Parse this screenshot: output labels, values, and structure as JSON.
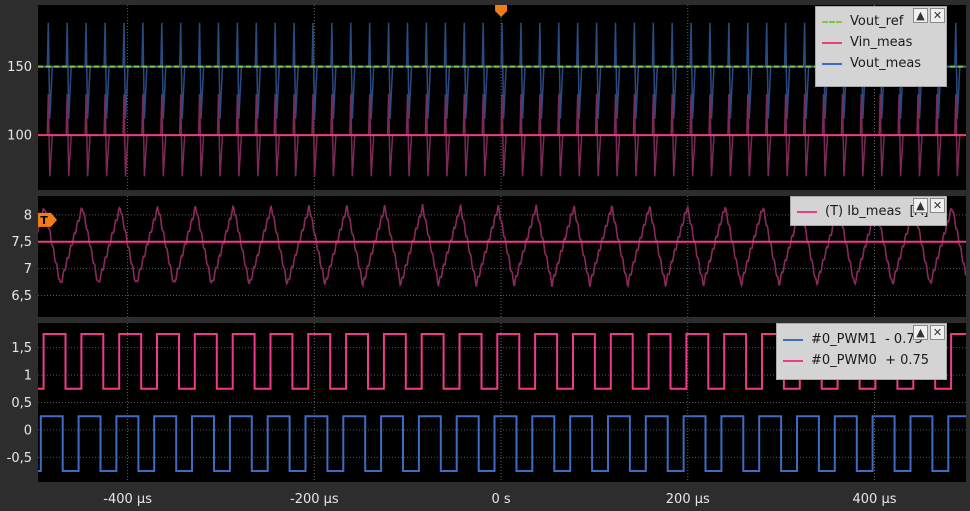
{
  "chart_data": [
    {
      "type": "line",
      "panel": "top",
      "yticks": [
        100,
        150
      ],
      "ylim": [
        60,
        195
      ],
      "x_ticks": [
        -400,
        -200,
        0,
        200,
        400
      ],
      "x_tick_labels": [
        "-400 µs",
        "-200 µs",
        "0 s",
        "200 µs",
        "400 µs"
      ],
      "xlim": [
        -496,
        498
      ],
      "grid": true,
      "legend_position": "top-right",
      "series": [
        {
          "name": "Vout_ref",
          "color": "#7ec843",
          "style": "dashed",
          "value": 150
        },
        {
          "name": "Vin_meas",
          "color": "#ee3b86",
          "value": 100,
          "spike_range": [
            70,
            130
          ]
        },
        {
          "name": "Vout_meas",
          "color": "#3d6cc2",
          "value": 150,
          "spike_range": [
            112,
            182
          ]
        }
      ]
    },
    {
      "type": "line",
      "panel": "middle",
      "yticks": [
        6.5,
        7,
        7.5,
        8
      ],
      "ytick_labels": [
        "6,5",
        "7",
        "7,5",
        "8"
      ],
      "ylim": [
        6.1,
        8.35
      ],
      "grid": true,
      "trigger_marker": "T",
      "trigger_level": 8,
      "legend_position": "top-right",
      "series": [
        {
          "name": "(T) Ib_meas  [A]",
          "color": "#ee3b86",
          "mean": 7.5,
          "ripple_min": 6.7,
          "ripple_max": 8.15
        }
      ]
    },
    {
      "type": "line",
      "panel": "bottom",
      "yticks": [
        -0.5,
        0,
        0.5,
        1,
        1.5
      ],
      "ytick_labels": [
        "-0,5",
        "0",
        "0,5",
        "1",
        "1,5"
      ],
      "ylim": [
        -0.95,
        1.95
      ],
      "grid": true,
      "legend_position": "top-right",
      "series": [
        {
          "name": "#0_PWM1  - 0.75",
          "color": "#3d6cc2",
          "low": -0.75,
          "high": 0.25
        },
        {
          "name": "#0_PWM0  + 0.75",
          "color": "#ee3b86",
          "low": 0.75,
          "high": 1.75
        }
      ],
      "pwm_period_us": 40.5
    }
  ],
  "legend_buttons": {
    "minimize": "▲",
    "close": "✕"
  }
}
